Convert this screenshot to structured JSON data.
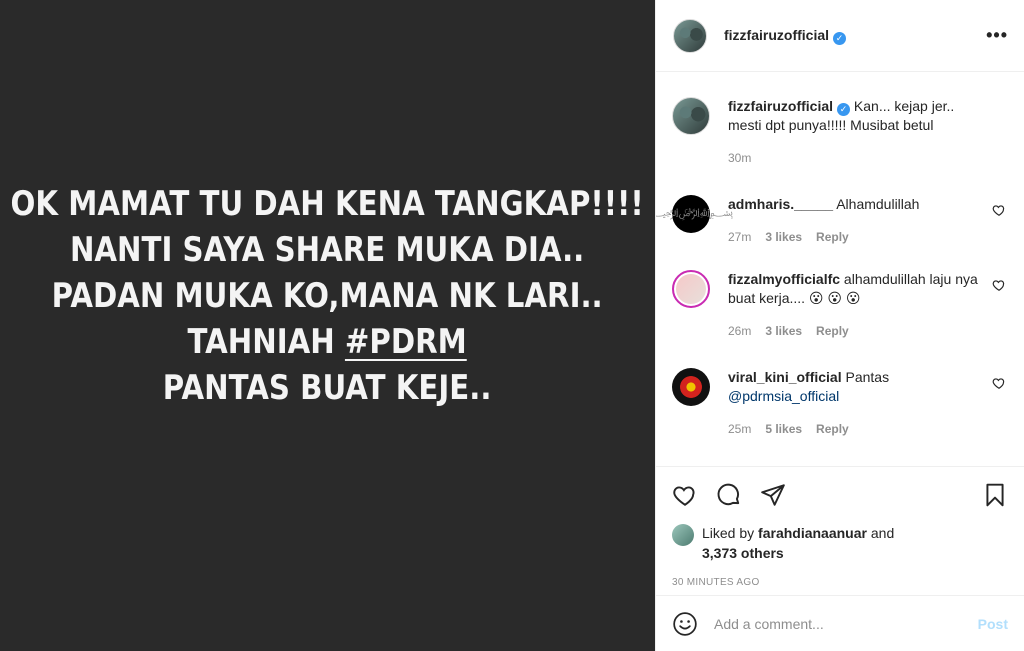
{
  "post": {
    "image_lines": [
      "OK MAMAT TU DAH KENA TANGKAP!!!!",
      "NANTI SAYA SHARE MUKA DIA..",
      "PADAN MUKA KO,MANA NK LARI..",
      "TAHNIAH",
      "#PDRM",
      "PANTAS BUAT KEJE.."
    ]
  },
  "header": {
    "username": "fizzfairuzofficial",
    "more": "•••"
  },
  "caption": {
    "username": "fizzfairuzofficial",
    "text": "Kan... kejap jer.. mesti dpt punya!!!!! Musibat betul",
    "time": "30m"
  },
  "comments": [
    {
      "username": "admharis._____",
      "text": "Alhamdulillah",
      "time": "27m",
      "likes": "3 likes",
      "reply": "Reply",
      "avatar_icon": "calligraphy-logo"
    },
    {
      "username": "fizzalmyofficialfc",
      "text": "alhamdulillah laju nya buat kerja.... 😮 😮 😮",
      "time": "26m",
      "likes": "3 likes",
      "reply": "Reply",
      "avatar_icon": "profile-photo"
    },
    {
      "username": "viral_kini_official",
      "text": "Pantas",
      "mention": "@pdrmsia_official",
      "time": "25m",
      "likes": "5 likes",
      "reply": "Reply",
      "avatar_icon": "viral-logo"
    }
  ],
  "likes": {
    "prefix": "Liked by",
    "user": "farahdianaanuar",
    "and": "and",
    "others": "3,373 others"
  },
  "timestamp": "30 MINUTES AGO",
  "add_comment": {
    "placeholder": "Add a comment...",
    "post_label": "Post"
  },
  "colors": {
    "image_bg": "#2a2a2a",
    "verified": "#3897f0",
    "link": "#00376b",
    "post_disabled": "#b2dffc"
  }
}
